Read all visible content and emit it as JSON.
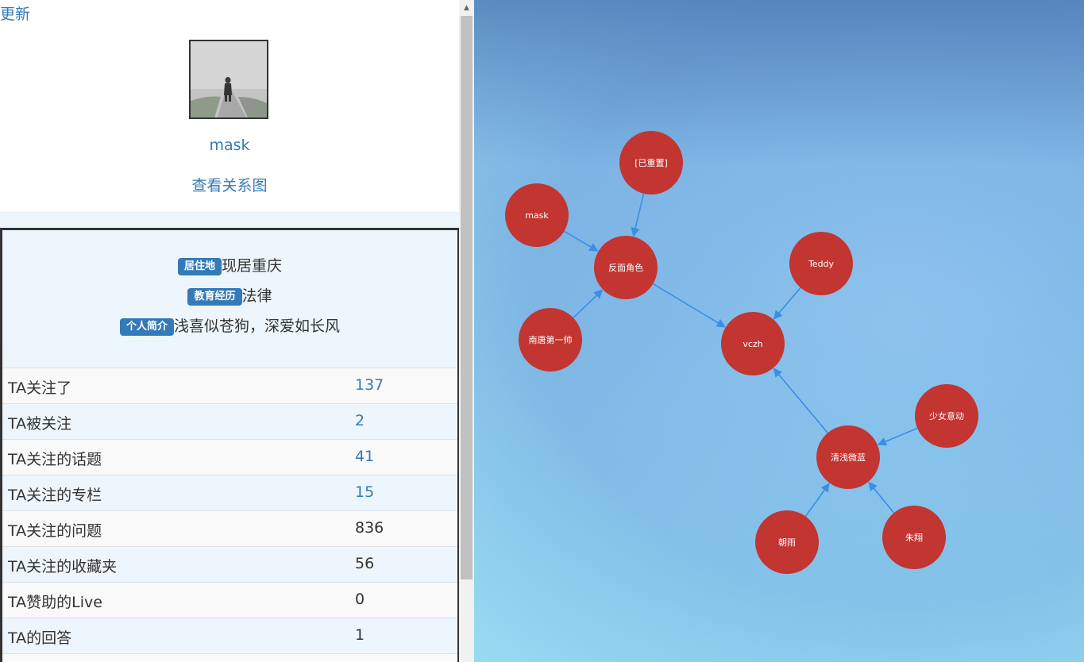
{
  "header": {
    "update_link": "更新"
  },
  "profile": {
    "username": "mask",
    "relation_link": "查看关系图",
    "info": [
      {
        "badge": "居住地",
        "text": "现居重庆"
      },
      {
        "badge": "教育经历",
        "text": "法律"
      },
      {
        "badge": "个人简介",
        "text": "浅喜似苍狗，深爱如长风"
      }
    ]
  },
  "stats": [
    {
      "label": "TA关注了",
      "value": "137",
      "link": true
    },
    {
      "label": "TA被关注",
      "value": "2",
      "link": true
    },
    {
      "label": "TA关注的话题",
      "value": "41",
      "link": true
    },
    {
      "label": "TA关注的专栏",
      "value": "15",
      "link": true
    },
    {
      "label": "TA关注的问题",
      "value": "836",
      "link": false
    },
    {
      "label": "TA关注的收藏夹",
      "value": "56",
      "link": false
    },
    {
      "label": "TA赞助的Live",
      "value": "0",
      "link": false
    },
    {
      "label": "TA的回答",
      "value": "1",
      "link": false
    }
  ],
  "graph": {
    "node_color": "#c23531",
    "edge_color": "#3a8ee6",
    "nodes": [
      {
        "id": "yichongzhi",
        "label": "[已重置]"
      },
      {
        "id": "mask",
        "label": "mask"
      },
      {
        "id": "fanmian",
        "label": "反面角色"
      },
      {
        "id": "teddy",
        "label": "Teddy"
      },
      {
        "id": "nantang",
        "label": "南唐第一帅"
      },
      {
        "id": "vczh",
        "label": "vczh"
      },
      {
        "id": "shaonv",
        "label": "少女意动"
      },
      {
        "id": "qingqian",
        "label": "清浅微蓝"
      },
      {
        "id": "zhaoyu",
        "label": "朝雨"
      },
      {
        "id": "zhuxiang",
        "label": "朱翔"
      }
    ],
    "edges": [
      {
        "from": "yichongzhi",
        "to": "fanmian"
      },
      {
        "from": "mask",
        "to": "fanmian"
      },
      {
        "from": "nantang",
        "to": "fanmian"
      },
      {
        "from": "fanmian",
        "to": "vczh"
      },
      {
        "from": "teddy",
        "to": "vczh"
      },
      {
        "from": "qingqian",
        "to": "vczh"
      },
      {
        "from": "shaonv",
        "to": "qingqian"
      },
      {
        "from": "zhaoyu",
        "to": "qingqian"
      },
      {
        "from": "zhuxiang",
        "to": "qingqian"
      }
    ]
  }
}
